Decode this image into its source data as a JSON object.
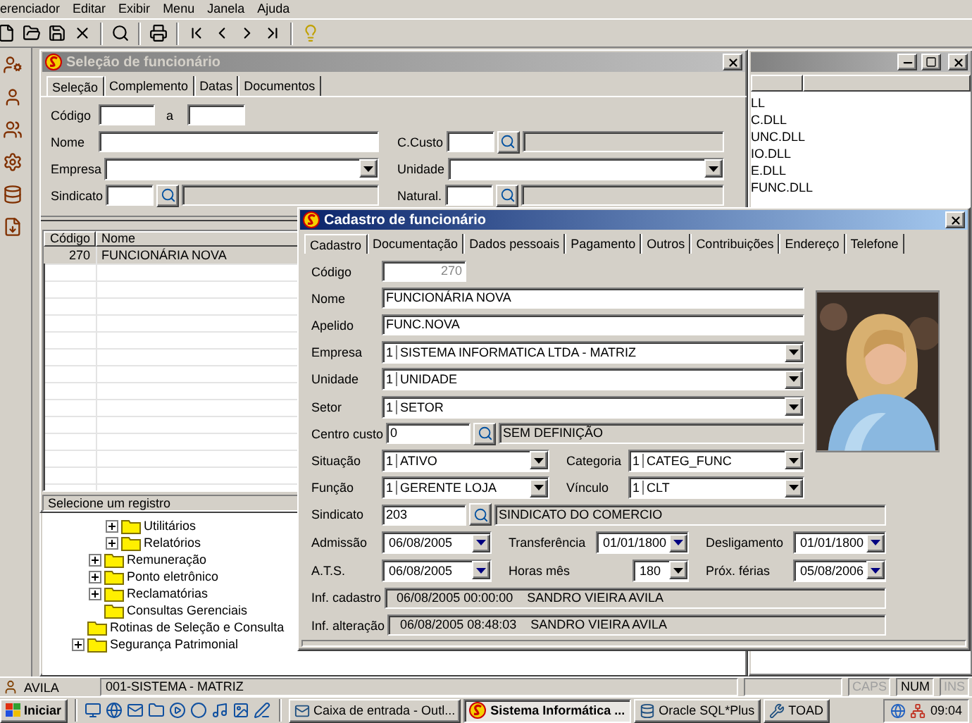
{
  "menu": [
    "erenciador",
    "Editar",
    "Exibir",
    "Menu",
    "Janela",
    "Ajuda"
  ],
  "selection_window": {
    "title": "Seleção de funcionário",
    "active": false,
    "tabs": [
      {
        "label": "Seleção",
        "selected": true
      },
      {
        "label": "Complemento",
        "selected": false
      },
      {
        "label": "Datas",
        "selected": false
      },
      {
        "label": "Documentos",
        "selected": false
      }
    ],
    "filters_left": [
      {
        "label": "Código",
        "kind": "range",
        "separator": "a"
      },
      {
        "label": "Nome",
        "kind": "text"
      },
      {
        "label": "Empresa",
        "kind": "combo"
      },
      {
        "label": "Sindicato",
        "kind": "lookup"
      }
    ],
    "filters_right": [
      {
        "label": "C.Custo",
        "kind": "lookup"
      },
      {
        "label": "Unidade",
        "kind": "combo"
      },
      {
        "label": "Natural.",
        "kind": "lookup"
      }
    ],
    "grid": {
      "columns": [
        "Código",
        "Nome"
      ],
      "rows": [
        {
          "cells": [
            "270",
            "FUNCIONÁRIA NOVA"
          ],
          "selected": true
        }
      ]
    },
    "status": "Selecione um registro"
  },
  "tree": [
    {
      "children": [
        {
          "children": [
            {
              "label": "Utilitários",
              "expandable": true
            },
            {
              "label": "Relatórios",
              "expandable": true
            }
          ]
        },
        {
          "label": "Remuneração",
          "expandable": true
        },
        {
          "label": "Ponto eletrônico",
          "expandable": true
        },
        {
          "label": "Reclamatórias",
          "expandable": true
        },
        {
          "label": "Consultas Gerenciais",
          "expandable": false
        }
      ]
    },
    {
      "label": "Rotinas de Seleção e Consulta",
      "expandable": false
    },
    {
      "label": "Segurança Patrimonial",
      "expandable": true
    }
  ],
  "file_window": {
    "active": false,
    "files": [
      "LL",
      "C.DLL",
      "UNC.DLL",
      "IO.DLL",
      "E.DLL",
      "FUNC.DLL"
    ]
  },
  "dialog": {
    "title": "Cadastro de funcionário",
    "active": true,
    "tabs": [
      {
        "label": "Cadastro",
        "selected": true
      },
      {
        "label": "Documentação",
        "selected": false
      },
      {
        "label": "Dados pessoais",
        "selected": false
      },
      {
        "label": "Pagamento",
        "selected": false
      },
      {
        "label": "Outros",
        "selected": false
      },
      {
        "label": "Contribuições",
        "selected": false
      },
      {
        "label": "Endereço",
        "selected": false
      },
      {
        "label": "Telefone",
        "selected": false
      }
    ],
    "top_rows": [
      [
        {
          "label": "Código",
          "kind": "code",
          "value": "270"
        }
      ],
      [
        {
          "label": "Nome",
          "kind": "text",
          "value": "FUNCIONÁRIA NOVA"
        }
      ],
      [
        {
          "label": "Apelido",
          "kind": "text",
          "value": "FUNC.NOVA"
        }
      ],
      [
        {
          "label": "Empresa",
          "kind": "combo",
          "code": "1",
          "value": "SISTEMA INFORMATICA LTDA - MATRIZ"
        }
      ],
      [
        {
          "label": "Unidade",
          "kind": "combo",
          "code": "1",
          "value": "UNIDADE"
        }
      ],
      [
        {
          "label": "Setor",
          "kind": "combo",
          "code": "1",
          "value": "SETOR"
        }
      ],
      [
        {
          "label": "Centro custo",
          "kind": "lookup",
          "value": "0",
          "description": "SEM DEFINIÇÃO"
        }
      ],
      [
        {
          "label": "Situação",
          "kind": "combo",
          "code": "1",
          "value": "ATIVO"
        },
        {
          "label": "Categoria",
          "kind": "combo",
          "code": "1",
          "value": "CATEG_FUNC"
        }
      ],
      [
        {
          "label": "Função",
          "kind": "combo",
          "code": "1",
          "value": "GERENTE LOJA"
        },
        {
          "label": "Vínculo",
          "kind": "combo",
          "code": "1",
          "value": "CLT"
        }
      ]
    ],
    "bottom_rows": [
      [
        {
          "label": "Sindicato",
          "kind": "lookup",
          "value": "203",
          "description": "SINDICATO DO COMERCIO"
        }
      ],
      [
        {
          "label": "Admissão",
          "kind": "date",
          "value": "06/08/2005"
        },
        {
          "label": "Transferência",
          "kind": "date",
          "value": "01/01/1800"
        },
        {
          "label": "Desligamento",
          "kind": "date",
          "value": "01/01/1800"
        }
      ],
      [
        {
          "label": "A.T.S.",
          "kind": "date",
          "value": "06/08/2005"
        },
        {
          "label": "Horas mês",
          "kind": "spin",
          "value": "180"
        },
        {
          "label": "Próx. férias",
          "kind": "date",
          "value": "05/08/2006"
        }
      ],
      [
        {
          "label": "Inf. cadastro",
          "kind": "info",
          "value": "06/08/2005 00:00:00",
          "user": "SANDRO VIEIRA AVILA"
        }
      ],
      [
        {
          "label": "Inf. alteração",
          "kind": "info",
          "value": "06/08/2005 08:48:03",
          "user": "SANDRO VIEIRA AVILA"
        }
      ]
    ]
  },
  "status": {
    "user": "AVILA",
    "company": "001-SISTEMA - MATRIZ",
    "indicators": [
      {
        "label": "CAPS",
        "on": false
      },
      {
        "label": "NUM",
        "on": true
      },
      {
        "label": "INS",
        "on": false
      }
    ]
  },
  "taskbar": {
    "start": "Iniciar",
    "tasks": [
      {
        "label": "Caixa de entrada - Outl...",
        "selected": false
      },
      {
        "label": "Sistema Informática ...",
        "selected": true
      },
      {
        "label": "Oracle SQL*Plus",
        "selected": false
      },
      {
        "label": "TOAD",
        "selected": false
      }
    ],
    "clock": "09:04"
  }
}
